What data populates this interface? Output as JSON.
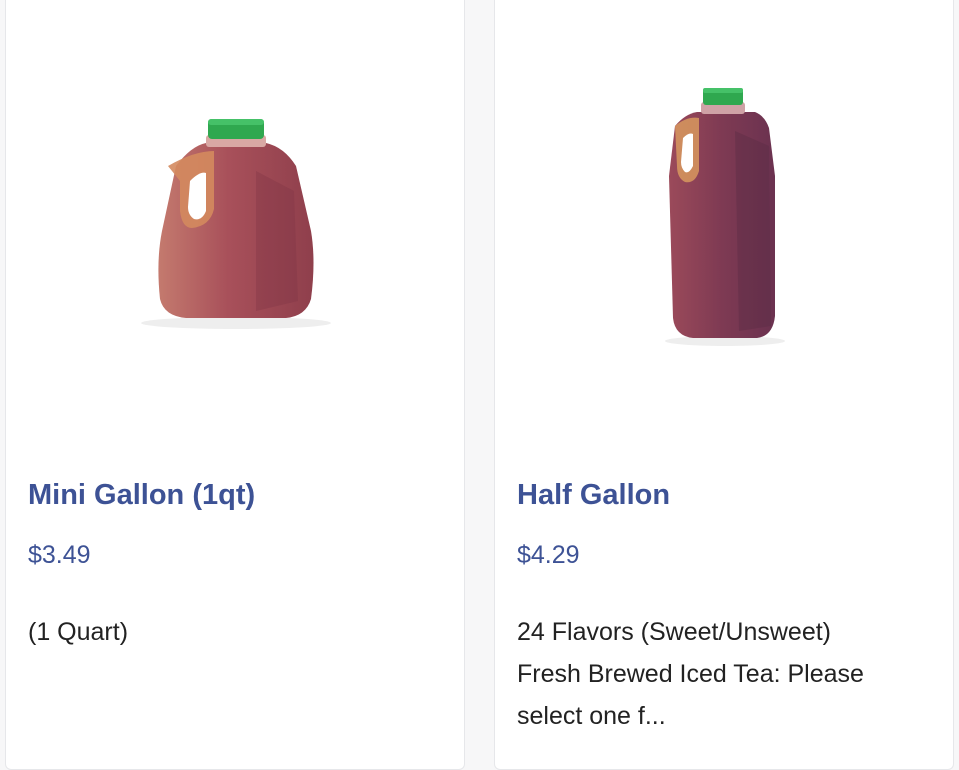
{
  "products": [
    {
      "name": "Mini Gallon (1qt)",
      "price": "$3.49",
      "description_lines": [
        "(1 Quart)"
      ],
      "image": "tea-jug-icon"
    },
    {
      "name": "Half Gallon",
      "price": "$4.29",
      "description_lines": [
        "24 Flavors (Sweet/Unsweet)",
        "Fresh Brewed Iced Tea: Please",
        "select one f..."
      ],
      "image": "tea-jug-icon"
    }
  ],
  "colors": {
    "title": "#3d5295",
    "price": "#3d5295",
    "text": "#222222",
    "cap": "#2fa84f",
    "tea": "#9b4146"
  }
}
